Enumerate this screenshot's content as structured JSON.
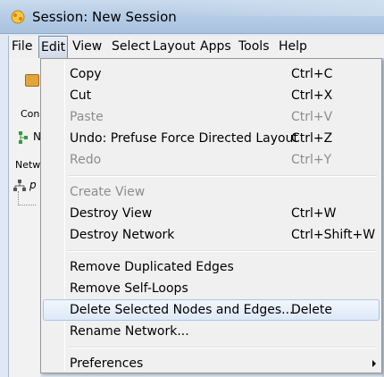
{
  "window": {
    "title": "Session: New Session"
  },
  "menubar": {
    "items": [
      {
        "label": "File"
      },
      {
        "label": "Edit"
      },
      {
        "label": "View"
      },
      {
        "label": "Select"
      },
      {
        "label": "Layout"
      },
      {
        "label": "Apps"
      },
      {
        "label": "Tools"
      },
      {
        "label": "Help"
      }
    ],
    "active": "Edit"
  },
  "background": {
    "panel_tab_label": "Con",
    "network_row_letter": "N",
    "network_column_label": "Netw",
    "tree_item_letter": "p"
  },
  "edit_menu": {
    "items": [
      {
        "label": "Copy",
        "shortcut": "Ctrl+C",
        "enabled": true
      },
      {
        "label": "Cut",
        "shortcut": "Ctrl+X",
        "enabled": true
      },
      {
        "label": "Paste",
        "shortcut": "Ctrl+V",
        "enabled": false
      },
      {
        "label": "Undo: Prefuse Force Directed Layout",
        "shortcut": "Ctrl+Z",
        "enabled": true
      },
      {
        "label": "Redo",
        "shortcut": "Ctrl+Y",
        "enabled": false
      },
      {
        "label": "Create View",
        "shortcut": "",
        "enabled": false
      },
      {
        "label": "Destroy View",
        "shortcut": "Ctrl+W",
        "enabled": true
      },
      {
        "label": "Destroy Network",
        "shortcut": "Ctrl+Shift+W",
        "enabled": true
      },
      {
        "label": "Remove Duplicated Edges",
        "shortcut": "",
        "enabled": true
      },
      {
        "label": "Remove Self-Loops",
        "shortcut": "",
        "enabled": true
      },
      {
        "label": "Delete Selected Nodes and Edges...",
        "shortcut": "Delete",
        "enabled": true,
        "highlighted": true
      },
      {
        "label": "Rename Network...",
        "shortcut": "",
        "enabled": true
      },
      {
        "label": "Preferences",
        "shortcut": "",
        "enabled": true,
        "submenu": true
      }
    ]
  }
}
